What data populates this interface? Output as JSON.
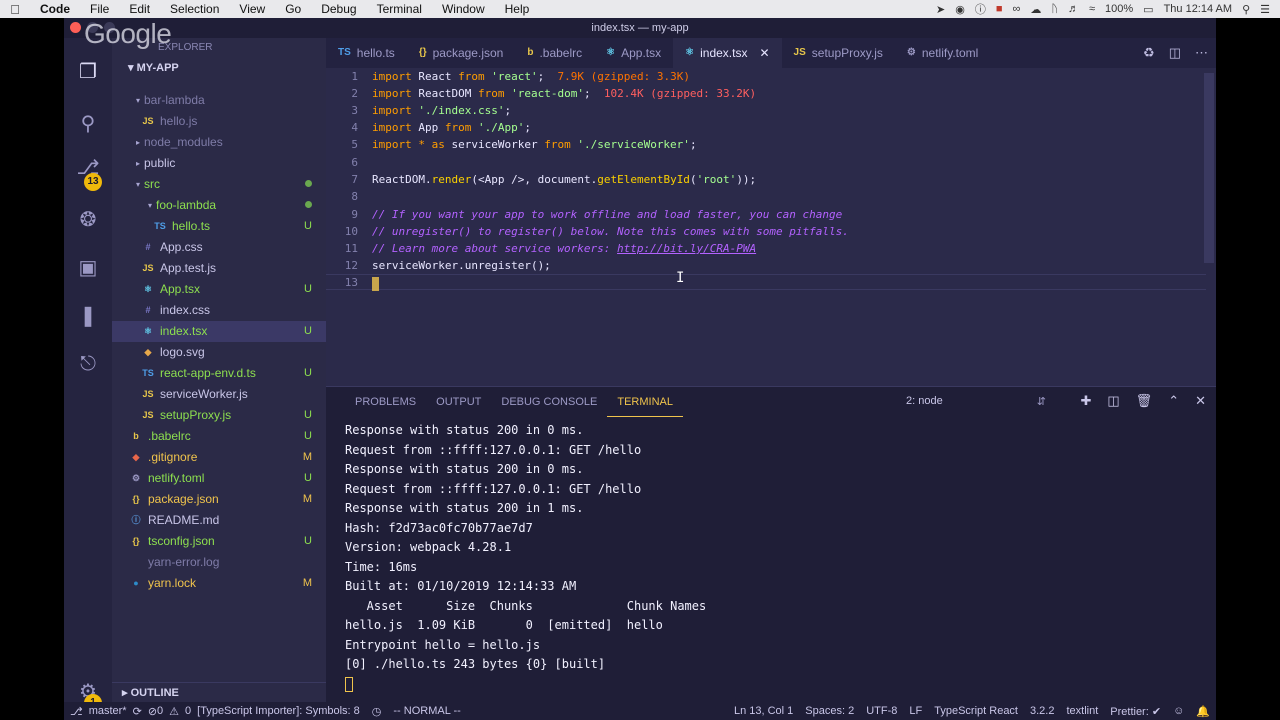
{
  "menubar": {
    "app": "Code",
    "items": [
      "File",
      "Edit",
      "Selection",
      "View",
      "Go",
      "Debug",
      "Terminal",
      "Window",
      "Help"
    ],
    "battery": "100%",
    "clock": "Thu 12:14 AM"
  },
  "window": {
    "title": "index.tsx — my-app"
  },
  "overlay_logo": "Google",
  "activity": {
    "scm_badge": "13",
    "settings_badge": "1"
  },
  "sidebar": {
    "header": "EXPLORER",
    "project": "MY-APP",
    "items": [
      {
        "name": "bar-lambda",
        "status": ""
      },
      {
        "name": "hello.js",
        "status": ""
      },
      {
        "name": "node_modules",
        "status": ""
      },
      {
        "name": "public",
        "status": ""
      },
      {
        "name": "src",
        "status": ""
      },
      {
        "name": "foo-lambda",
        "status": ""
      },
      {
        "name": "hello.ts",
        "status": "U"
      },
      {
        "name": "App.css",
        "status": ""
      },
      {
        "name": "App.test.js",
        "status": ""
      },
      {
        "name": "App.tsx",
        "status": "U"
      },
      {
        "name": "index.css",
        "status": ""
      },
      {
        "name": "index.tsx",
        "status": "U"
      },
      {
        "name": "logo.svg",
        "status": ""
      },
      {
        "name": "react-app-env.d.ts",
        "status": "U"
      },
      {
        "name": "serviceWorker.js",
        "status": ""
      },
      {
        "name": "setupProxy.js",
        "status": "U"
      },
      {
        "name": ".babelrc",
        "status": "U"
      },
      {
        "name": ".gitignore",
        "status": "M"
      },
      {
        "name": "netlify.toml",
        "status": "U"
      },
      {
        "name": "package.json",
        "status": "M"
      },
      {
        "name": "README.md",
        "status": ""
      },
      {
        "name": "tsconfig.json",
        "status": "U"
      },
      {
        "name": "yarn-error.log",
        "status": ""
      },
      {
        "name": "yarn.lock",
        "status": "M"
      }
    ],
    "outline": "OUTLINE"
  },
  "tabs": [
    {
      "label": "hello.ts",
      "icon": "TS"
    },
    {
      "label": "package.json",
      "icon": "{}"
    },
    {
      "label": ".babelrc",
      "icon": "b"
    },
    {
      "label": "App.tsx",
      "icon": "⚛"
    },
    {
      "label": "index.tsx",
      "icon": "⚛"
    },
    {
      "label": "setupProxy.js",
      "icon": "JS"
    },
    {
      "label": "netlify.toml",
      "icon": "⚙"
    }
  ],
  "editor": {
    "line_numbers": [
      "1",
      "2",
      "3",
      "4",
      "5",
      "6",
      "7",
      "8",
      "9",
      "10",
      "11",
      "12",
      "13"
    ],
    "import_size_react": "7.9K (gzipped: 3.3K)",
    "import_size_reactdom": "102.4K (gzipped: 33.2K)",
    "comment_1": "// If you want your app to work offline and load faster, you can change",
    "comment_2": "// unregister() to register() below. Note this comes with some pitfalls.",
    "comment_3_prefix": "// Learn more about service workers: ",
    "comment_3_link": "http://bit.ly/CRA-PWA",
    "line_12": "serviceWorker.unregister();"
  },
  "panel": {
    "tabs": [
      "PROBLEMS",
      "OUTPUT",
      "DEBUG CONSOLE",
      "TERMINAL"
    ],
    "terminal_select": "2: node",
    "lines": [
      "Response with status 200 in 0 ms.",
      "Request from ::ffff:127.0.0.1: GET /hello",
      "Response with status 200 in 0 ms.",
      "Request from ::ffff:127.0.0.1: GET /hello",
      "Response with status 200 in 1 ms.",
      "Hash: f2d73ac0fc70b77ae7d7",
      "Version: webpack 4.28.1",
      "Time: 16ms",
      "Built at: 01/10/2019 12:14:33 AM",
      "   Asset      Size  Chunks             Chunk Names",
      "hello.js  1.09 KiB       0  [emitted]  hello",
      "Entrypoint hello = hello.js",
      "[0] ./hello.ts 243 bytes {0} [built]"
    ]
  },
  "statusbar": {
    "branch": "master*",
    "errors": "0",
    "warnings": "0",
    "importer": "[TypeScript Importer]: Symbols: 8",
    "vim_mode": "-- NORMAL --",
    "position": "Ln 13, Col 1",
    "spaces": "Spaces: 2",
    "encoding": "UTF-8",
    "eol": "LF",
    "language": "TypeScript React",
    "ts_version": "3.2.2",
    "linter": "textlint",
    "prettier": "Prettier: ✔"
  }
}
